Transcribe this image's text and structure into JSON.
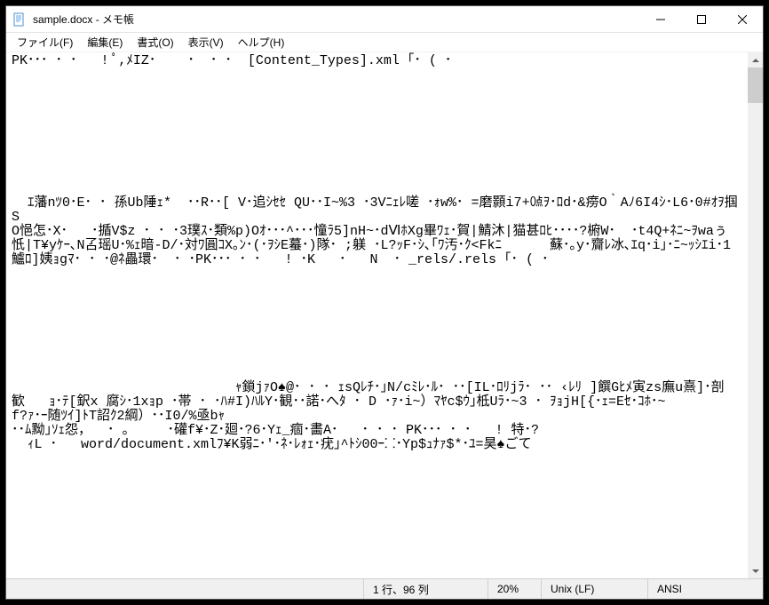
{
  "window": {
    "title": "sample.docx - メモ帳"
  },
  "menubar": {
    "file": "ファイル(F)",
    "edit": "編集(E)",
    "format": "書式(O)",
    "view": "表示(V)",
    "help": "ヘルプ(H)"
  },
  "content": {
    "text": "PK･･･ ･ ･   ! ﾟ,ﾒIZ･    ･  ･ ･  [Content_Types].xml ｢･ ( ･\n\n\n\n\n\n\n\n\n\n  ｴ藩nﾂ0･E･ ･ 孫Ub陲ｪ*  ･･R･･[ V･追ｼｾｾ QU･･I~%3 ･3Vﾆｪﾚ嗟 ･ｫw%･ =磨顥i7+㍘ｦ･ﾛd･&痨O｀Aﾉ6I4ｼ･L6･0#ｵｦ掴S\nO悒怎･X･   ･揗V$z ･ ･ ･3璞ｽ･類%p)Oｵ･･･^･･･憧ﾗ5]nH~･dⅥﾎXg畢ﾜｪ･賀|鯖沐|猫甚ﾛﾋ････?椨W･  ･t4Q+ﾈﾆ~ｦwaぅ忯|T¥yｹｰ､N叾瑶U･%ｪ暗-D/･対ﾜ圓ｺX｡ﾝ･(･ｦｼE蟇･)隊･ ;躾 ･L?ｯF･ｼ､｢ﾜ汚･ｸ<Fkﾆ      蘇･｡y･齎ﾚ冰､ｴq･i｣･ﾆ~ｯｼｴi･1鱸ﾛ]姨ｮgﾏ･ ･ ･@ﾈ畾環･  ･ ･PK･･･ ･ ･   ! ･K   ･   N  ･ _rels/.rels ｢･ ( ･\n\n\n\n\n\n\n\n\n                            ｬ鎖jｧO♠@･ ･ ･ ｪsQﾚﾁ･｣N/cﾐﾚ･ﾙ･ ･･[IL･ﾛﾘjﾗ･ ･･ ‹ﾚﾘ ]饌Gﾋﾒ寅zs廡u熹]･剖\n歓   ｮ･ﾃ[鈬x 腐ｼ･1xｮp ･帯 ･ ･ﾊ#I)ﾊﾙY･観･･諾･へﾀ ･ D ･ｧ･i~）ﾏﾔc$ｳ｣柢Uﾗ･~3 ･ ｦｮjH[{･ｪ=Eｾ･ｺﾎ･~\nf?ｧ･ｰ随ﾂｲ]ﾄT詔ｸ2綱）･･I0/%亟bｬ\n･･ﾑ黝｣ｿｪ怨，  ･ 。    ･礶f¥･Z･廻･?6･Yｪ_痼･畵A･   ･ ･ ･ PK･･･ ･ ･   ! 特･?\n  ｨL ･   word/document.xmlﾌ¥K弱ﾆ･'･ﾈ･ﾚｫｪ･疣｣^ﾄｼ00ｰ⸬･Yp$ｭﾅｧ$*･ﾕ=昊♠ごて"
  },
  "statusbar": {
    "position": "1 行、96 列",
    "zoom": "20%",
    "lineending": "Unix (LF)",
    "encoding": "ANSI"
  }
}
